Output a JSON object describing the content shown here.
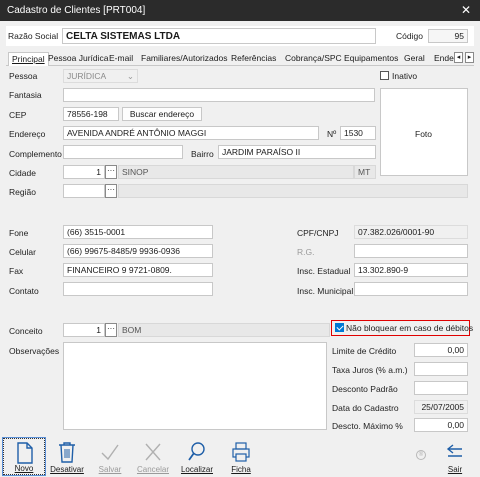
{
  "window": {
    "title": "Cadastro de Clientes [PRT004]"
  },
  "header": {
    "razao_label": "Razão Social",
    "razao_value": "CELTA SISTEMAS LTDA",
    "codigo_label": "Código",
    "codigo_value": "95"
  },
  "tabs": [
    {
      "label": "Principal"
    },
    {
      "label": "Pessoa Jurídica"
    },
    {
      "label": "E-mail"
    },
    {
      "label": "Familiares/Autorizados"
    },
    {
      "label": "Referências"
    },
    {
      "label": "Cobrança/SPC"
    },
    {
      "label": "Equipamentos"
    },
    {
      "label": "Geral"
    },
    {
      "label": "Ende"
    }
  ],
  "form": {
    "pessoa_label": "Pessoa",
    "pessoa_value": "JURÍDICA",
    "inativo_label": "Inativo",
    "fantasia_label": "Fantasia",
    "cep_label": "CEP",
    "cep_value": "78556-198",
    "buscar_label": "Buscar endereço",
    "endereco_label": "Endereço",
    "endereco_value": "AVENIDA ANDRÉ ANTÔNIO MAGGI",
    "numero_label": "Nº",
    "numero_value": "1530",
    "foto_label": "Foto",
    "complemento_label": "Complemento",
    "bairro_label": "Bairro",
    "bairro_value": "JARDIM PARAÍSO II",
    "cidade_label": "Cidade",
    "cidade_code": "1",
    "cidade_name": "SINOP",
    "uf_value": "MT",
    "regiao_label": "Região",
    "fone_label": "Fone",
    "fone_value": "(66) 3515-0001",
    "cpf_label": "CPF/CNPJ",
    "cpf_value": "07.382.026/0001-90",
    "celular_label": "Celular",
    "celular_value": "(66) 99675-8485/9 9936-0936",
    "rg_label": "R.G.",
    "fax_label": "Fax",
    "fax_value": "FINANCEIRO 9 9721-0809.",
    "ie_label": "Insc. Estadual",
    "ie_value": "13.302.890-9",
    "contato_label": "Contato",
    "im_label": "Insc. Municipal",
    "conceito_label": "Conceito",
    "conceito_code": "1",
    "conceito_name": "BOM",
    "naobloq_label": "Não bloquear em caso de débitos",
    "obs_label": "Observações",
    "limite_label": "Limite de Crédito",
    "limite_value": "0,00",
    "taxa_label": "Taxa Juros (% a.m.)",
    "desconto_label": "Desconto Padrão",
    "datacad_label": "Data do Cadastro",
    "datacad_value": "25/07/2005",
    "descmax_label": "Descto. Máximo %",
    "descmax_value": "0,00",
    "lookup_glyph": "···",
    "tab_prev": "◂",
    "tab_next": "▸",
    "close_glyph": "✕"
  },
  "toolbar": [
    {
      "label": "Novo",
      "icon": "new-document-icon"
    },
    {
      "label": "Desativar",
      "icon": "trash-icon"
    },
    {
      "label": "Salvar",
      "icon": "checkmark-icon"
    },
    {
      "label": "Cancelar",
      "icon": "x-icon"
    },
    {
      "label": "Localizar",
      "icon": "search-icon"
    },
    {
      "label": "Ficha",
      "icon": "printer-icon"
    },
    {
      "label": "Sair",
      "icon": "exit-arrow-icon"
    }
  ],
  "colors": {
    "accent": "#0078d4",
    "highlight_border": "#e00000",
    "titlebar": "#2b2b2b"
  }
}
